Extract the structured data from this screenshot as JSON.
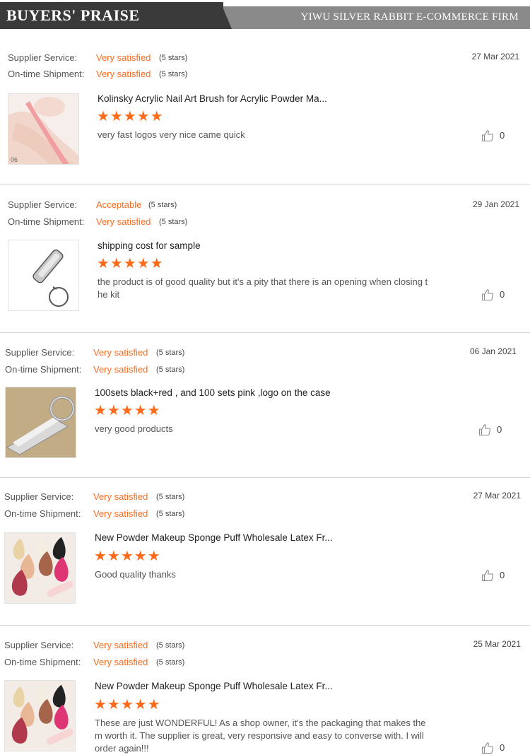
{
  "header": {
    "title": "BUYERS' PRAISE",
    "firm": "YIWU SILVER RABBIT E-COMMERCE FIRM"
  },
  "labels": {
    "supplier_service": "Supplier Service:",
    "shipment": "On-time Shipment:"
  },
  "colors": {
    "accent": "#ff6a1a",
    "banner_dark": "#3a3a3a",
    "banner_light": "#8a8a8a"
  },
  "reviews": [
    {
      "supplier_value": "Very satisfied",
      "supplier_stars": "(5 stars)",
      "shipment_value": "Very satisfied",
      "shipment_stars": "(5 stars)",
      "date": "27 Mar 2021",
      "product": "Kolinsky Acrylic Nail Art Brush for Acrylic Powder Ma...",
      "rating": 5,
      "stars": "★★★★★",
      "comment": "very fast logos very nice came quick",
      "likes": "0",
      "image": "foot-with-pink-brush"
    },
    {
      "supplier_value": "Acceptable",
      "supplier_stars": "(5 stars)",
      "shipment_value": "Very satisfied",
      "shipment_stars": "(5 stars)",
      "date": "29 Jan 2021",
      "product": "shipping cost for sample",
      "rating": 5,
      "stars": "★★★★★",
      "comment": "the product is of good quality but it's a pity that there is an opening when closing t\nhe kit",
      "likes": "0",
      "image": "nail-clipper-keyring"
    },
    {
      "supplier_value": "Very satisfied",
      "supplier_stars": "(5 stars)",
      "shipment_value": "Very satisfied",
      "shipment_stars": "(5 stars)",
      "date": "06 Jan 2021",
      "product": "100sets black+red , and 100 sets pink ,logo on the case",
      "rating": 5,
      "stars": "★★★★★",
      "comment": "very good products",
      "likes": "0",
      "image": "nail-clipper-closeup"
    },
    {
      "supplier_value": "Very satisfied",
      "supplier_stars": "(5 stars)",
      "shipment_value": "Very satisfied",
      "shipment_stars": "(5 stars)",
      "date": "27 Mar 2021",
      "product": "New Powder Makeup Sponge Puff Wholesale Latex Fr...",
      "rating": 5,
      "stars": "★★★★★",
      "comment": "Good quality thanks",
      "likes": "0",
      "image": "makeup-sponges"
    },
    {
      "supplier_value": "Very satisfied",
      "supplier_stars": "(5 stars)",
      "shipment_value": "Very satisfied",
      "shipment_stars": "(5 stars)",
      "date": "25 Mar 2021",
      "product": "New Powder Makeup Sponge Puff Wholesale Latex Fr...",
      "rating": 5,
      "stars": "★★★★★",
      "comment": "These are just WONDERFUL!  As a shop owner, it's the packaging that makes the\nm worth it.  The supplier is great, very responsive and easy to converse with.  I will\norder again!!!",
      "likes": "0",
      "image": "makeup-sponges"
    }
  ]
}
